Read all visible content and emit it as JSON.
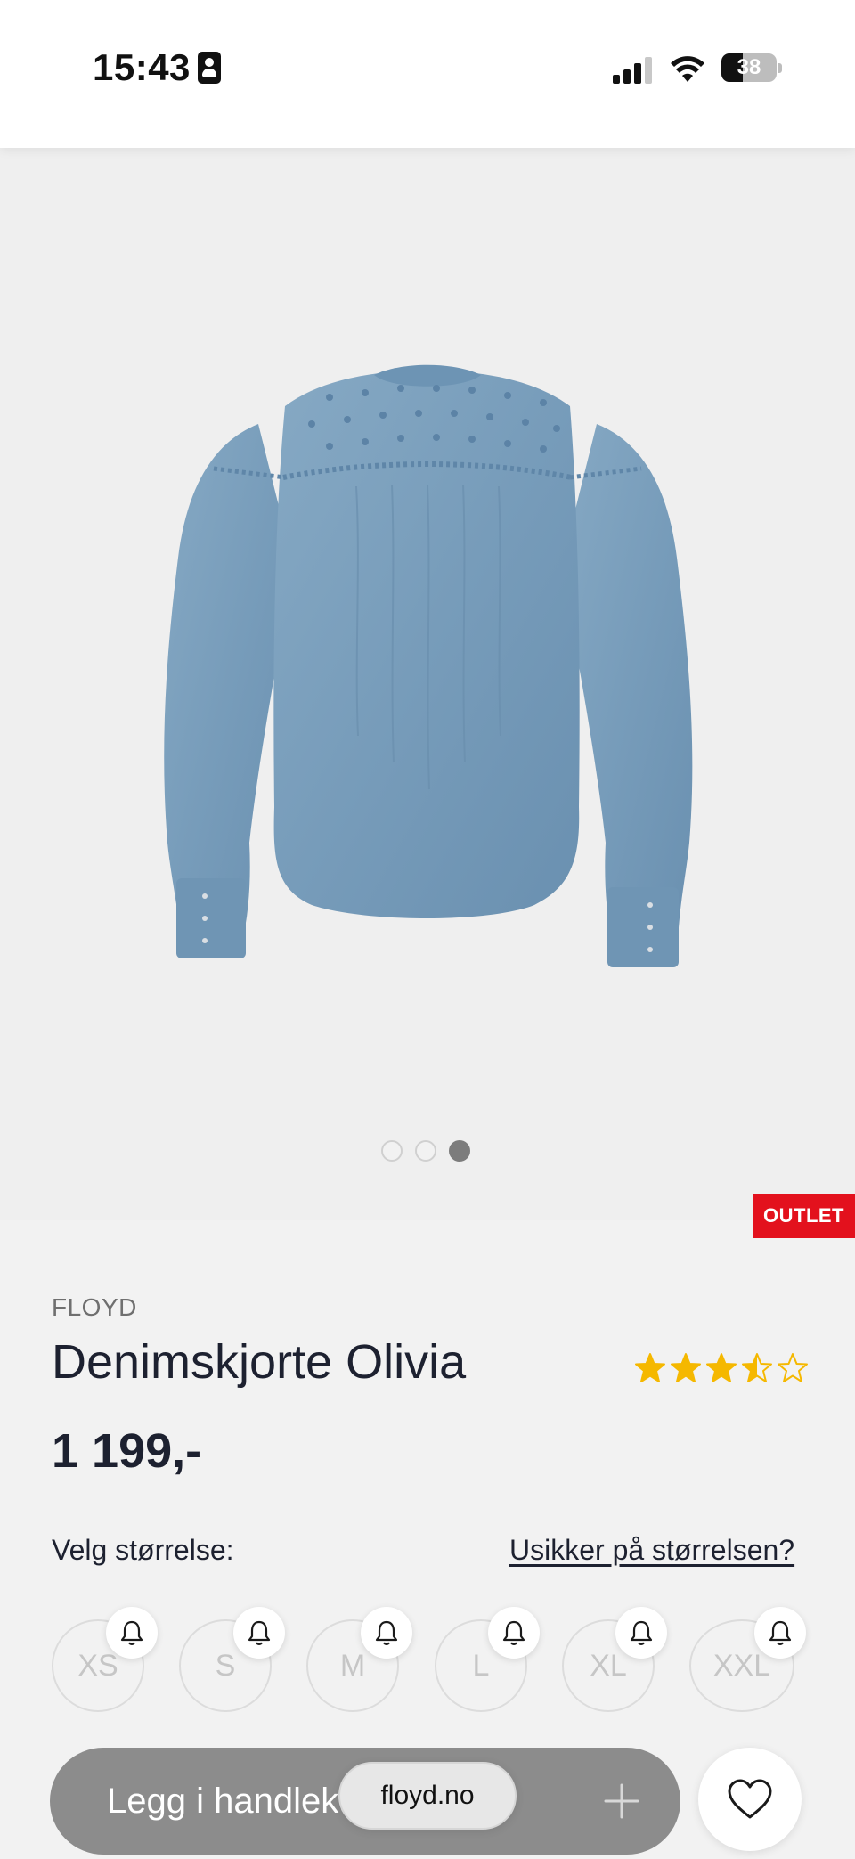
{
  "status_bar": {
    "time": "15:43",
    "battery_level": "38",
    "battery_fraction": 0.38,
    "signal_bars_active": 3,
    "icons": [
      "person-card-icon",
      "cellular-signal-icon",
      "wifi-icon",
      "battery-icon"
    ]
  },
  "gallery": {
    "image_alt": "denim-shirt-back-view",
    "image_count": 3,
    "active_index": 2
  },
  "badge": {
    "label": "OUTLET",
    "color": "#e3111d"
  },
  "product": {
    "brand": "FLOYD",
    "name": "Denimskjorte Olivia",
    "price": "1 199,-",
    "rating": 3.5,
    "rating_max": 5
  },
  "sizes": {
    "label": "Velg størrelse:",
    "help_link": "Usikker på størrelsen?",
    "options": [
      "XS",
      "S",
      "M",
      "L",
      "XL",
      "XXL"
    ],
    "all_unavailable": true
  },
  "actions": {
    "add_to_cart": "Legg i handlekurv",
    "url": "floyd.no",
    "plus_icon": "plus-icon",
    "wishlist_icon": "heart-outline-icon"
  },
  "colors": {
    "accent_red": "#e3111d",
    "star": "#f5b800",
    "cart_button": "#8c8c8c",
    "text": "#1d2130"
  }
}
